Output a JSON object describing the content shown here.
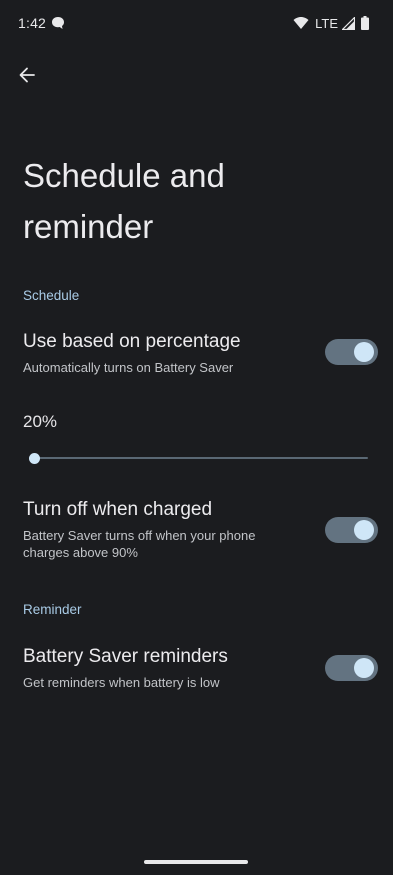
{
  "status_bar": {
    "time": "1:42",
    "network": "LTE",
    "icons": [
      "chat-icon",
      "wifi-icon",
      "signal-icon",
      "battery-icon"
    ]
  },
  "header": {
    "back_icon": "arrow-back-icon",
    "title": "Schedule and reminder"
  },
  "schedule": {
    "header": "Schedule",
    "use_percentage": {
      "title": "Use based on percentage",
      "summary": "Automatically turns on Battery Saver",
      "enabled": true
    },
    "slider": {
      "value_label": "20%",
      "level_fraction": 0.0
    },
    "turn_off_charged": {
      "title": "Turn off when charged",
      "summary": "Battery Saver turns off when your phone charges above 90%",
      "enabled": true
    }
  },
  "reminder": {
    "header": "Reminder",
    "battery_saver_reminders": {
      "title": "Battery Saver reminders",
      "summary": "Get reminders when battery is low",
      "enabled": true
    }
  },
  "colors": {
    "background": "#1b1c1f",
    "accent": "#a9cbe6",
    "toggle_track": "#637381",
    "toggle_thumb": "#cfe6f7"
  }
}
